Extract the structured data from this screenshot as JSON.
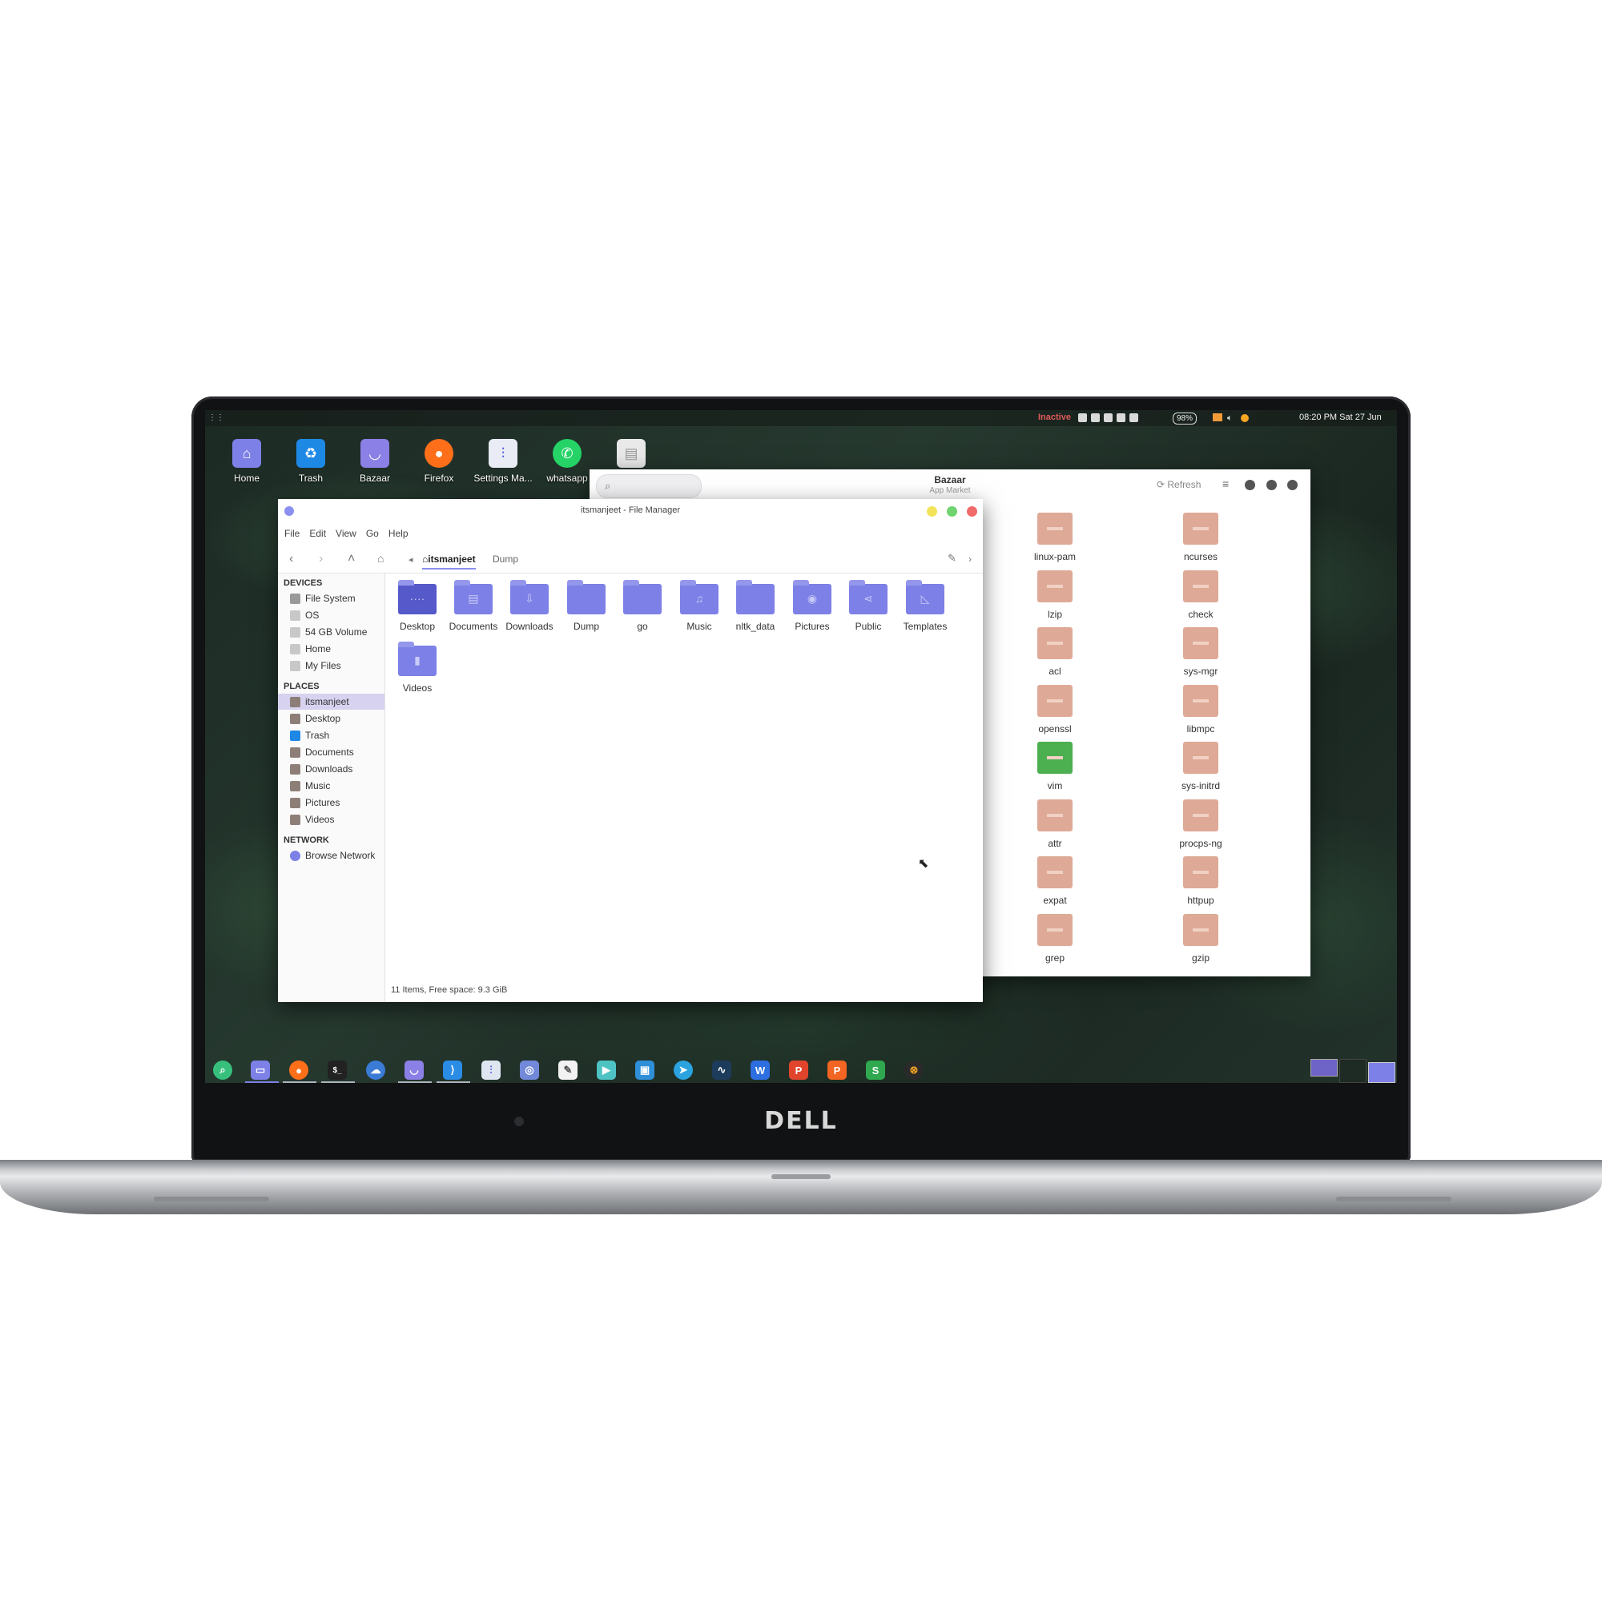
{
  "device": {
    "brand": "DELL"
  },
  "top_panel": {
    "status": "Inactive",
    "battery": "98%",
    "clock": "08:20 PM Sat 27 Jun"
  },
  "desktop_icons": [
    {
      "label": "Home",
      "icon": "home-folder-icon",
      "color": "#7d80e6"
    },
    {
      "label": "Trash",
      "icon": "trash-icon",
      "color": "#1e88e5"
    },
    {
      "label": "Bazaar",
      "icon": "bag-icon",
      "color": "#8b80e6"
    },
    {
      "label": "Firefox",
      "icon": "firefox-icon",
      "color": "#ff6f1a"
    },
    {
      "label": "Settings Ma...",
      "icon": "settings-icon",
      "color": "#e9ecf5"
    },
    {
      "label": "whatsapp",
      "icon": "whatsapp-icon",
      "color": "#25d366"
    },
    {
      "label": "",
      "icon": "document-icon",
      "color": "#e9e9e9"
    }
  ],
  "bazaar": {
    "title": "Bazaar",
    "subtitle": "App Market",
    "refresh_label": "Refresh",
    "packages": [
      "linux-pam",
      "ncurses",
      "lzip",
      "check",
      "acl",
      "sys-mgr",
      "openssl",
      "libmpc",
      "vim",
      "sys-initrd",
      "attr",
      "procps-ng",
      "expat",
      "httpup",
      "grep",
      "gzip"
    ]
  },
  "file_manager": {
    "title": "itsmanjeet - File Manager",
    "menu": [
      "File",
      "Edit",
      "View",
      "Go",
      "Help"
    ],
    "breadcrumb": {
      "home": "itsmanjeet",
      "next": "Dump"
    },
    "sidebar": {
      "devices_heading": "DEVICES",
      "devices": [
        "File System",
        "OS",
        "54 GB Volume",
        "Home",
        "My Files"
      ],
      "places_heading": "PLACES",
      "places": [
        "itsmanjeet",
        "Desktop",
        "Trash",
        "Documents",
        "Downloads",
        "Music",
        "Pictures",
        "Videos"
      ],
      "network_heading": "NETWORK",
      "network": [
        "Browse Network"
      ]
    },
    "folders": [
      "Desktop",
      "Documents",
      "Downloads",
      "Dump",
      "go",
      "Music",
      "nltk_data",
      "Pictures",
      "Public",
      "Templates",
      "Videos"
    ],
    "status": "11 Items, Free space: 9.3 GiB"
  },
  "dock": [
    {
      "icon": "search-icon",
      "color": "#36c07c"
    },
    {
      "icon": "file-manager-icon",
      "color": "#7d80e6"
    },
    {
      "icon": "firefox-icon",
      "color": "#ff6f1a"
    },
    {
      "icon": "terminal-icon",
      "color": "#222222"
    },
    {
      "icon": "chat-icon",
      "color": "#3a7bd5"
    },
    {
      "icon": "bazaar-icon",
      "color": "#8b80e6"
    },
    {
      "icon": "vscode-icon",
      "color": "#2b8ce6"
    },
    {
      "icon": "settings-icon",
      "color": "#dfe6f2"
    },
    {
      "icon": "discord-icon",
      "color": "#7289da"
    },
    {
      "icon": "text-editor-icon",
      "color": "#f2f2f2"
    },
    {
      "icon": "video-editor-icon",
      "color": "#4fc3c3"
    },
    {
      "icon": "image-viewer-icon",
      "color": "#2f8fd8"
    },
    {
      "icon": "telegram-icon",
      "color": "#2aa3df"
    },
    {
      "icon": "system-monitor-icon",
      "color": "#1d3b5a"
    },
    {
      "icon": "writer-icon",
      "color": "#2d6ee0"
    },
    {
      "icon": "pdf-icon",
      "color": "#e0452c"
    },
    {
      "icon": "presentation-icon",
      "color": "#f26522"
    },
    {
      "icon": "spreadsheet-icon",
      "color": "#2fa84f"
    },
    {
      "icon": "app-icon",
      "color": "#2a2a2a"
    }
  ]
}
